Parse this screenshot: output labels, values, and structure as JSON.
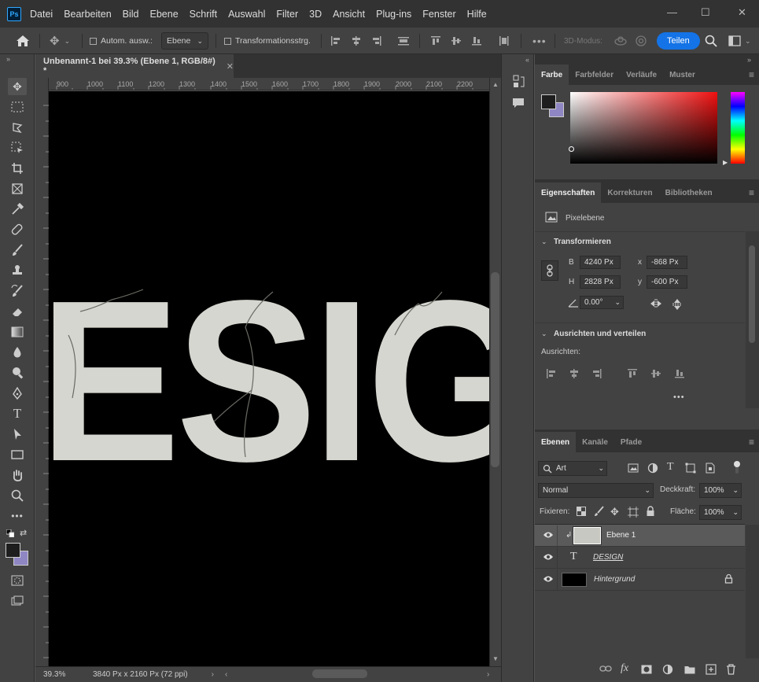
{
  "app": {
    "logo": "Ps"
  },
  "menu": [
    "Datei",
    "Bearbeiten",
    "Bild",
    "Ebene",
    "Schrift",
    "Auswahl",
    "Filter",
    "3D",
    "Ansicht",
    "Plug-ins",
    "Fenster",
    "Hilfe"
  ],
  "window_controls": {
    "minimize": "—",
    "maximize": "☐",
    "close": "✕"
  },
  "options": {
    "auto_select_label": "Autom. ausw.:",
    "auto_select_value": "Ebene",
    "transform_label": "Transformationsstrg.",
    "mode_3d": "3D-Modus:",
    "share": "Teilen"
  },
  "document": {
    "tab_title": "Unbenannt-1 bei 39.3% (Ebene 1, RGB/8#) *",
    "close": "✕",
    "ruler_ticks": [
      "900",
      "1000",
      "1100",
      "1200",
      "1300",
      "1400",
      "1500",
      "1600",
      "1700",
      "1800",
      "1900",
      "2000",
      "2100",
      "2200"
    ],
    "canvas_text": "ESIG",
    "zoom": "39.3%",
    "doc_info": "3840 Px x 2160 Px (72 ppi)"
  },
  "color_panel": {
    "tabs": [
      "Farbe",
      "Farbfelder",
      "Verläufe",
      "Muster"
    ],
    "foreground": "#1e1e1e",
    "background": "#8f86c4",
    "spectrum": [
      "#ff00ff",
      "#0000ff",
      "#00ffff",
      "#00ff00",
      "#ffff00",
      "#ff0000"
    ]
  },
  "properties_panel": {
    "tabs": [
      "Eigenschaften",
      "Korrekturen",
      "Bibliotheken"
    ],
    "layer_kind": "Pixelebene",
    "transform_title": "Transformieren",
    "w_label": "B",
    "w_value": "4240 Px",
    "h_label": "H",
    "h_value": "2828 Px",
    "x_label": "x",
    "x_value": "-868 Px",
    "y_label": "y",
    "y_value": "-600 Px",
    "angle_value": "0.00°",
    "align_title": "Ausrichten und verteilen",
    "align_label": "Ausrichten:",
    "more": "•••"
  },
  "layers_panel": {
    "tabs": [
      "Ebenen",
      "Kanäle",
      "Pfade"
    ],
    "filter_value": "Art",
    "blend_mode": "Normal",
    "opacity_label": "Deckkraft:",
    "opacity_value": "100%",
    "lock_label": "Fixieren:",
    "fill_label": "Fläche:",
    "fill_value": "100%",
    "layers": [
      {
        "name": "Ebene 1",
        "kind": "pixel",
        "selected": true
      },
      {
        "name": "DESIGN",
        "kind": "text",
        "selected": false
      },
      {
        "name": "Hintergrund",
        "kind": "background",
        "selected": false
      }
    ]
  }
}
